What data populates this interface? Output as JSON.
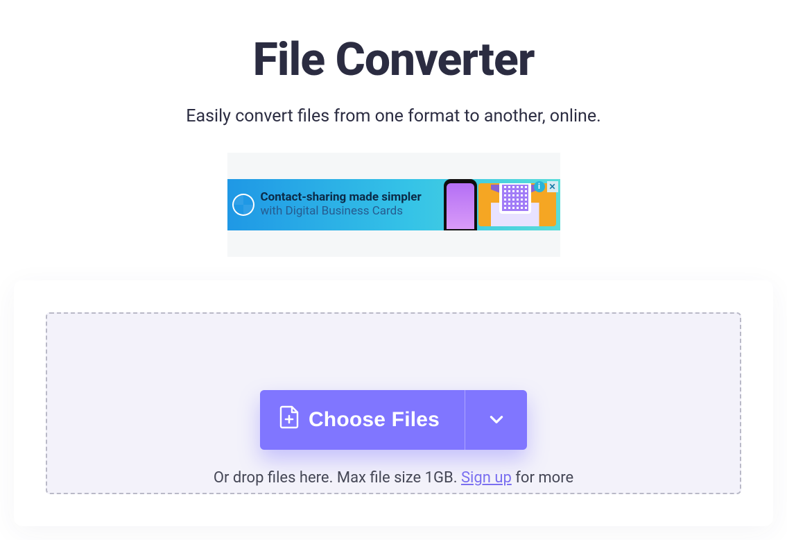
{
  "page": {
    "title": "File Converter",
    "subtitle": "Easily convert files from one format to another, online."
  },
  "ad": {
    "line1": "Contact-sharing made simpler",
    "line2": "with Digital Business Cards",
    "info_glyph": "i",
    "close_glyph": "✕"
  },
  "upload": {
    "button_label": "Choose Files",
    "drop_prefix": "Or drop files here. Max file size ",
    "max_size": "1GB",
    "drop_period": ". ",
    "signup_label": "Sign up",
    "drop_suffix": " for more"
  },
  "colors": {
    "accent": "#8076ff",
    "text": "#2b2c41",
    "dropzone_bg": "#f3f2fa",
    "dropzone_border": "#b9b9c7"
  }
}
